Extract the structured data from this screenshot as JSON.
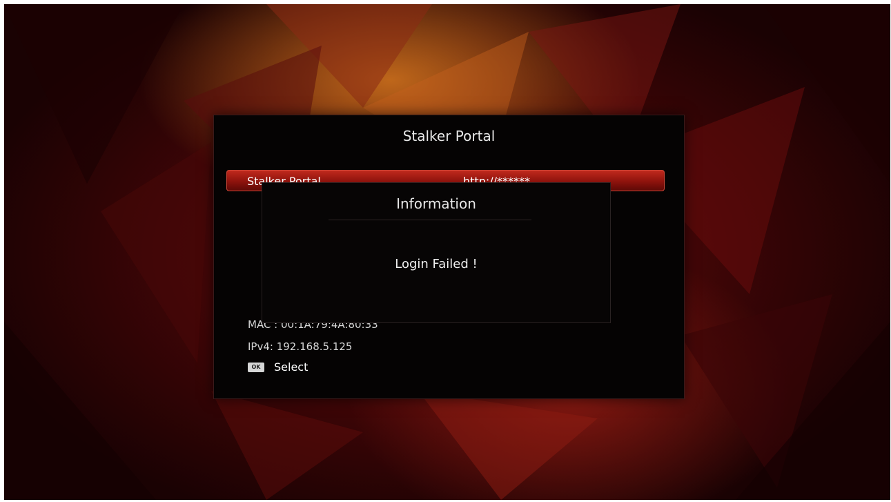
{
  "colors": {
    "accent_red": "#b0201a",
    "dialog_background": "#050303",
    "text": "#ffffff"
  },
  "dialog": {
    "title": "Stalker Portal",
    "portal_row": {
      "label": "Stalker Portal",
      "value": "http://******"
    },
    "mac": "MAC : 00:1A:79:4A:80:33",
    "ipv4": "IPv4: 192.168.5.125",
    "hint": {
      "key_label": "OK",
      "key_icon": "ok-key-icon",
      "label": "Select"
    }
  },
  "popup": {
    "title": "Information",
    "message": "Login Failed !"
  }
}
